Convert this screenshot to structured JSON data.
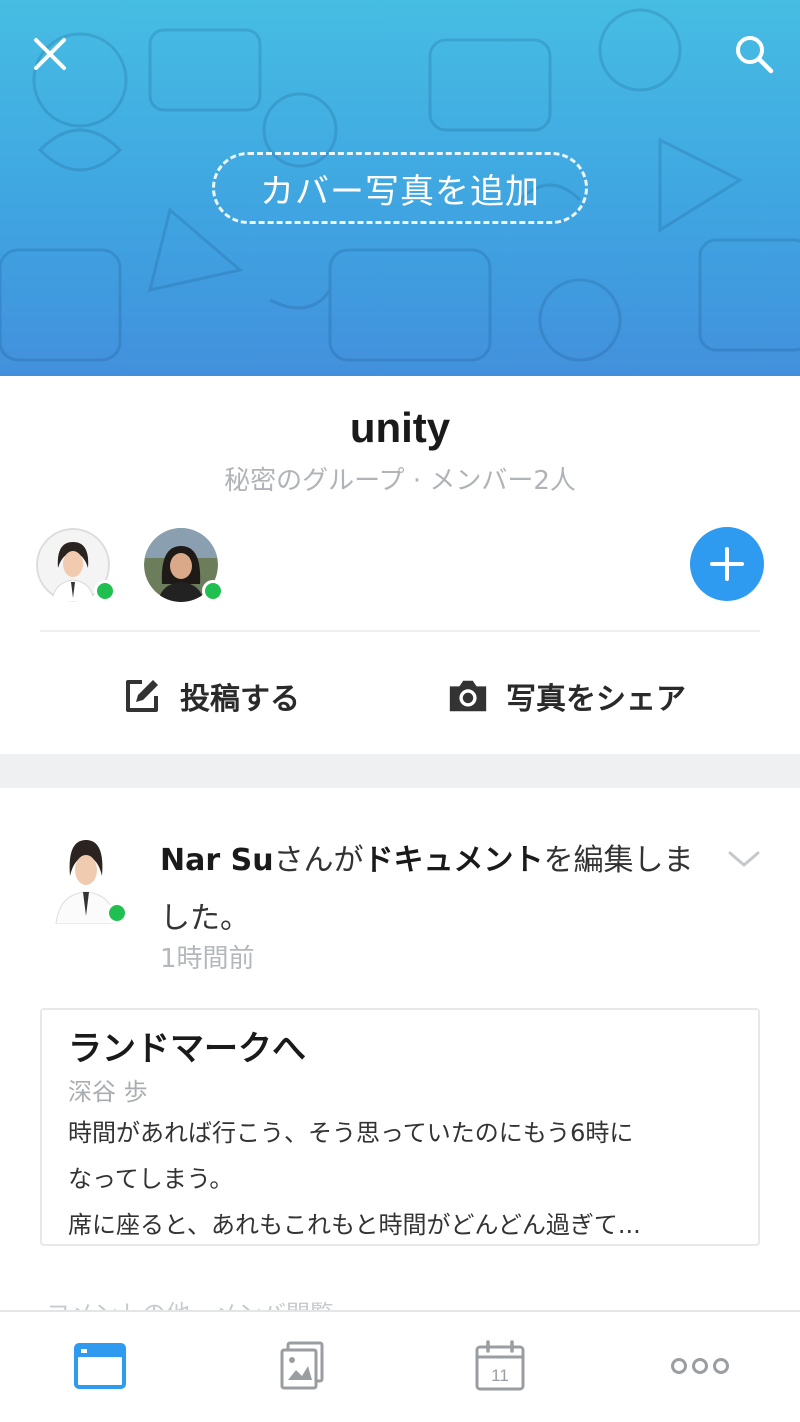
{
  "cover": {
    "add_cover_label": "カバー写真を追加",
    "gradient_top": "#46bde3",
    "gradient_bottom": "#4290dc"
  },
  "group": {
    "name": "unity",
    "subtitle": "秘密のグループ · メンバー2人"
  },
  "members": [
    {
      "online": true
    },
    {
      "online": true
    }
  ],
  "actions": {
    "post_label": "投稿する",
    "share_photo_label": "写真をシェア"
  },
  "post": {
    "actor": "Nar Su",
    "text_honorific": "さんが",
    "object": "ドキュメント",
    "text_rest": "を編集しました。",
    "time": "1時間前",
    "document": {
      "title": "ランドマークへ",
      "author": "深谷 歩",
      "lines": [
        "時間があれば行こう、そう思っていたのにもう6時に",
        "なってしまう。",
        "席に座ると、あれもこれもと時間がどんどん過ぎて..."
      ]
    },
    "faded_comment": "コメントの他、メンバ閲覧"
  },
  "colors": {
    "accent": "#2e9bf0",
    "online": "#1fc050",
    "tab_active": "#2e9bf0",
    "tab_inactive": "#9a9ea2"
  },
  "tabs": [
    {
      "icon": "board-icon",
      "active": true
    },
    {
      "icon": "album-icon",
      "active": false
    },
    {
      "icon": "calendar-icon",
      "day": "11",
      "active": false
    },
    {
      "icon": "more-icon",
      "active": false
    }
  ]
}
